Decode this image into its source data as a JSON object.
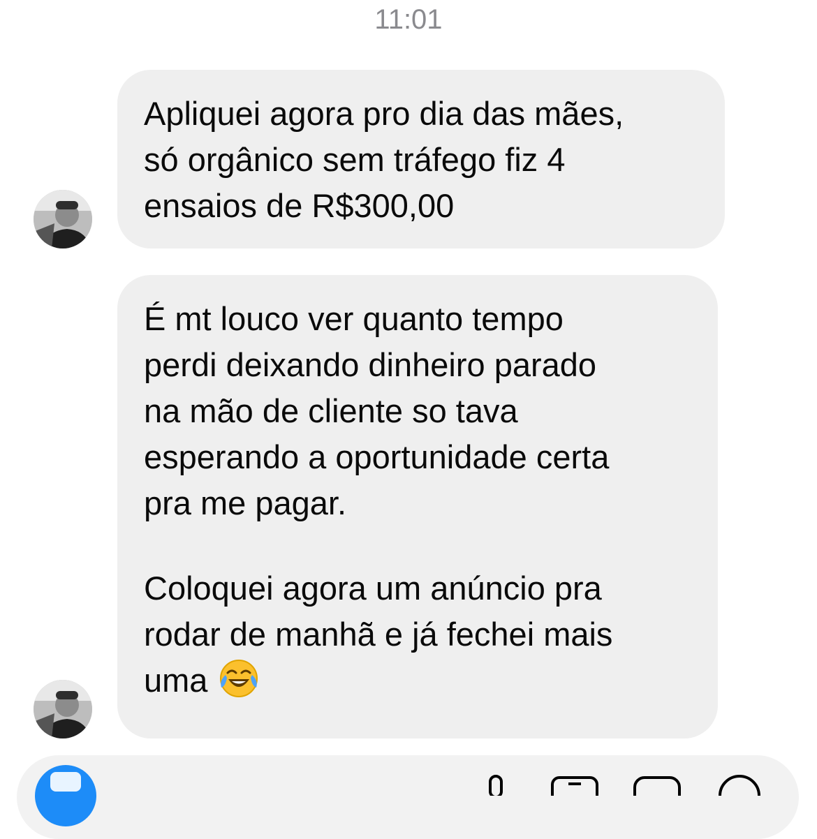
{
  "header": {
    "timestamp": "11:01"
  },
  "messages": [
    {
      "lines": [
        "Apliquei agora pro dia das mães,",
        "só orgânico sem tráfego fiz 4",
        "ensaios de R$300,00"
      ]
    },
    {
      "paragraph1": [
        "É mt louco ver quanto tempo",
        "perdi deixando dinheiro parado",
        "na mão de cliente so tava",
        "esperando a oportunidade certa",
        "pra me pagar."
      ],
      "paragraph2": [
        "Coloquei agora um anúncio pra",
        "rodar de manhã e já fechei mais",
        "uma"
      ],
      "emoji": "face-with-tears-of-joy"
    }
  ],
  "composer": {
    "icons": [
      "camera-icon",
      "microphone-icon",
      "gallery-icon",
      "sticker-icon",
      "plus-icon"
    ]
  },
  "colors": {
    "bubble": "#efefef",
    "timestamp": "#8a8a8e",
    "accent": "#1d8cf8"
  }
}
